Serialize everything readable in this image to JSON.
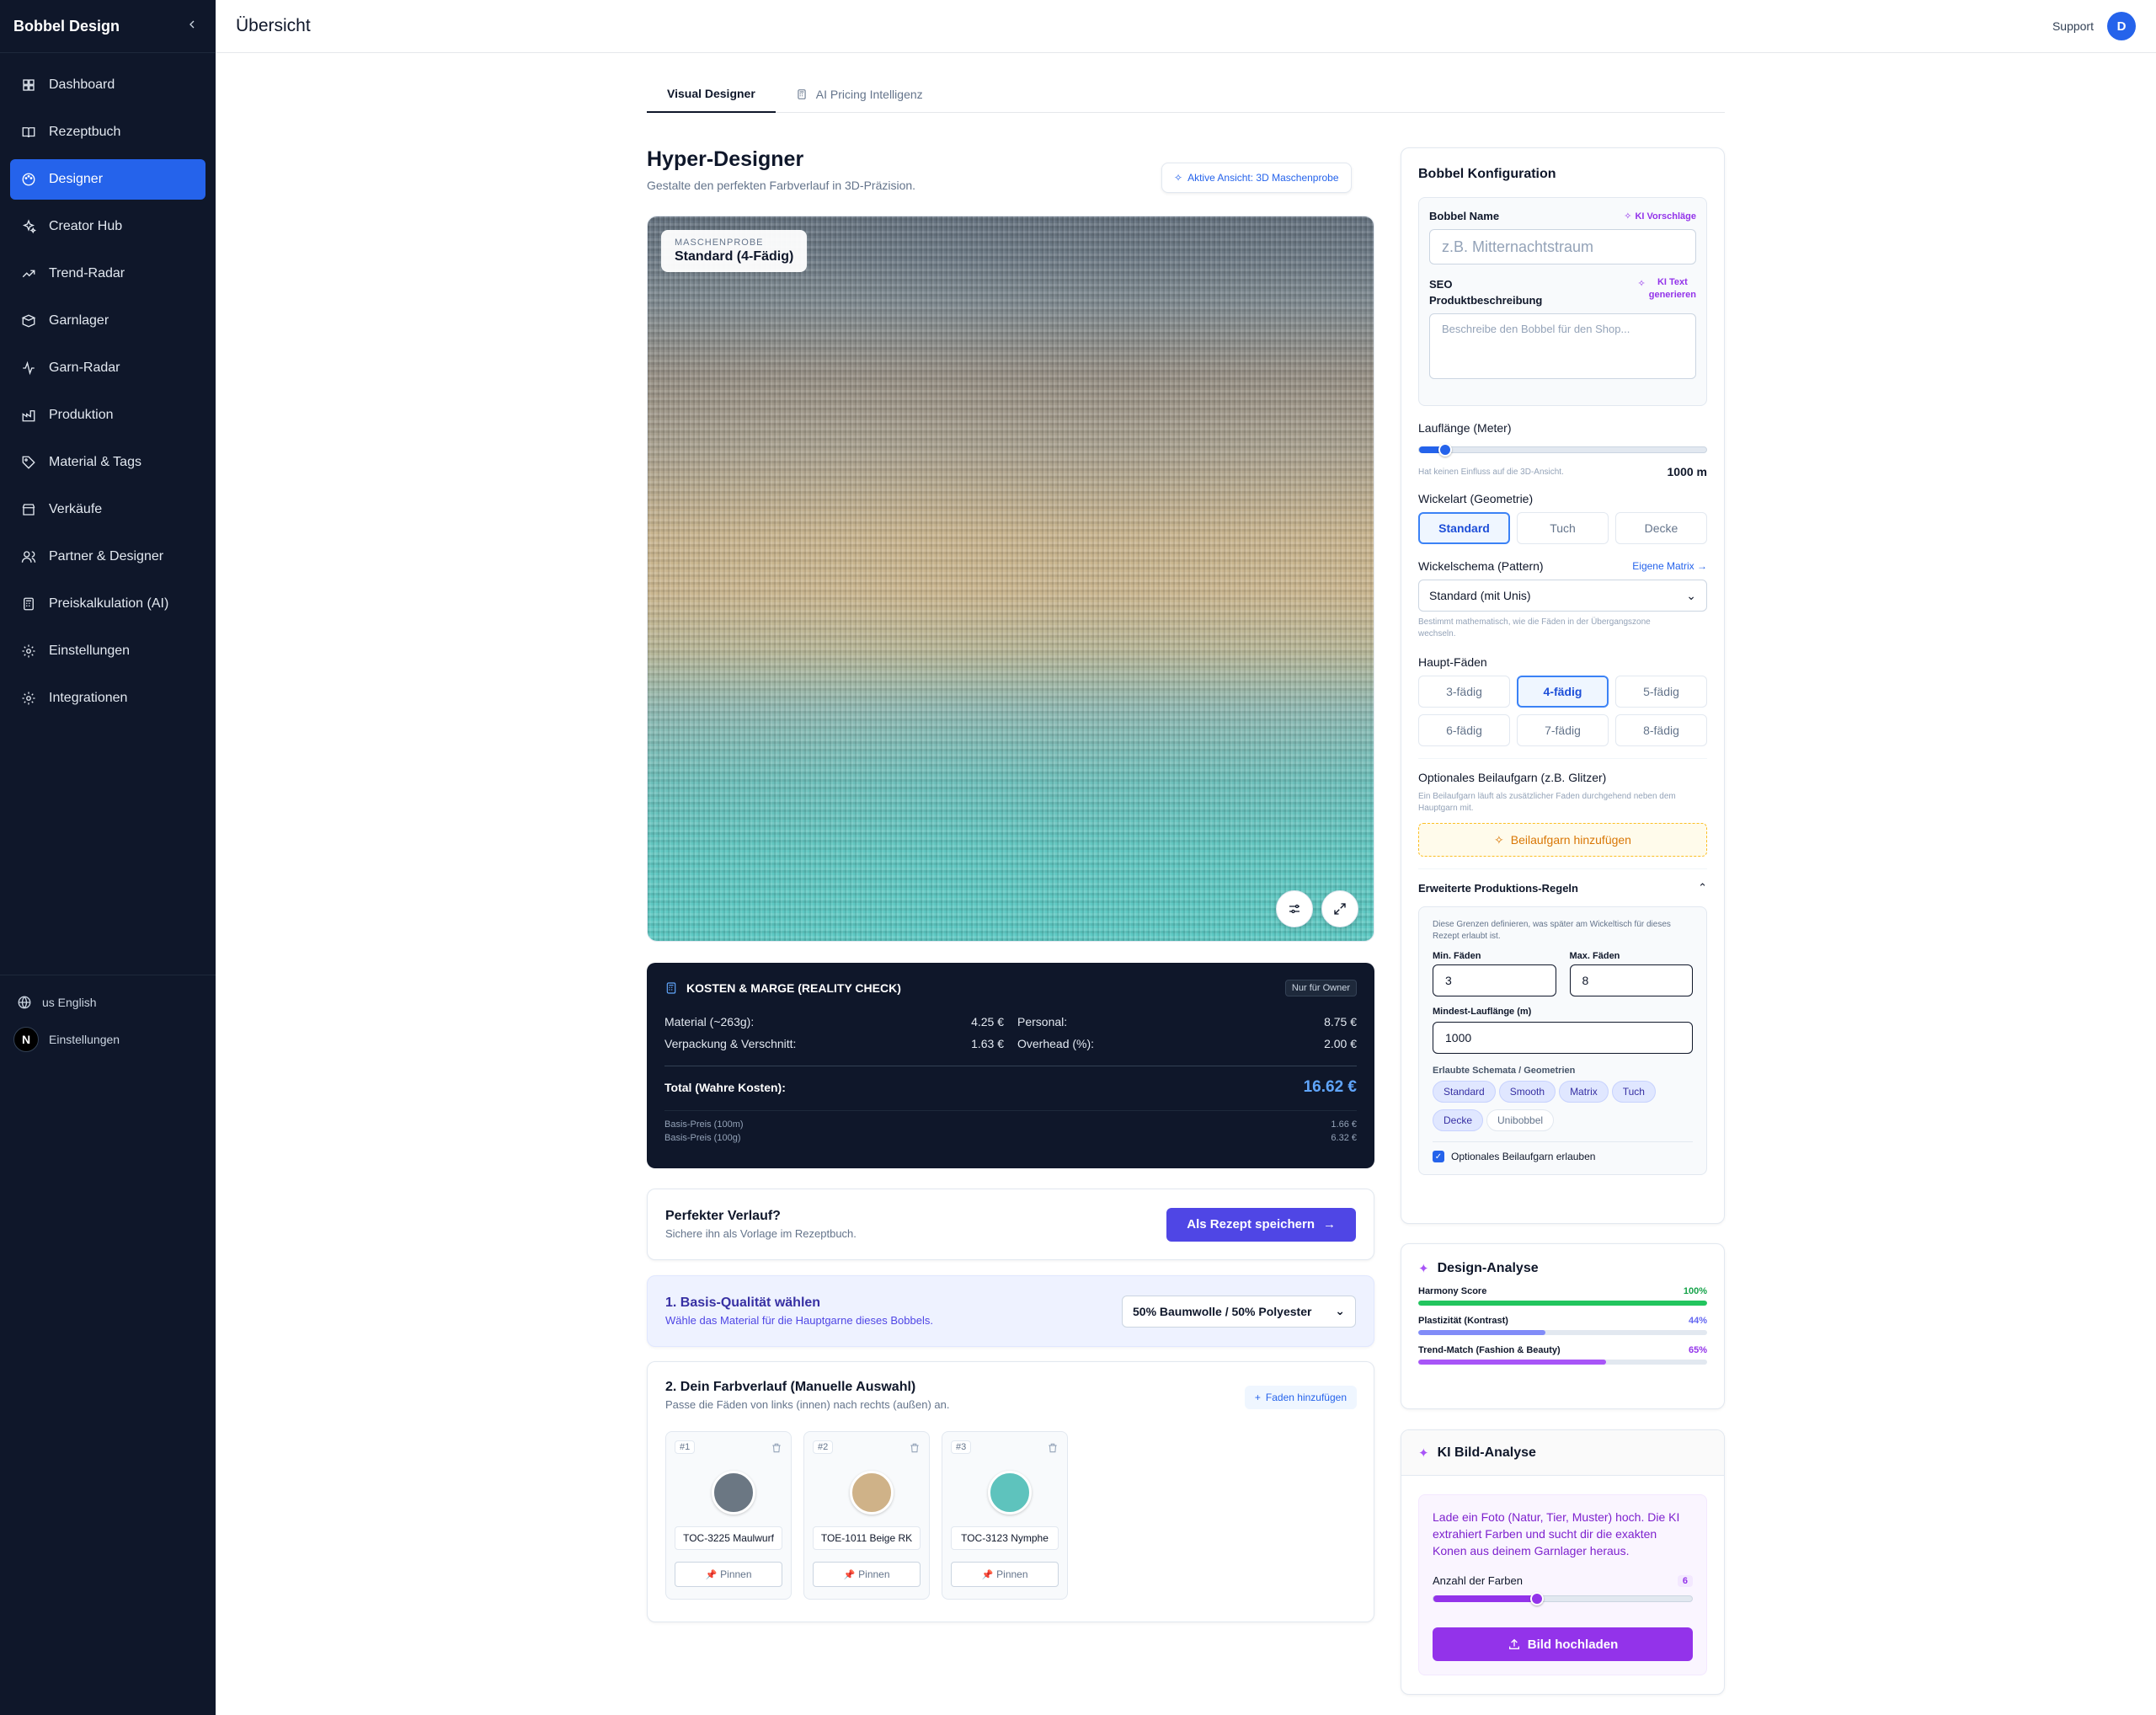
{
  "sidebar": {
    "brand": "Bobbel Design",
    "items": [
      {
        "label": "Dashboard",
        "icon": "dashboard-icon"
      },
      {
        "label": "Rezeptbuch",
        "icon": "book-icon"
      },
      {
        "label": "Designer",
        "icon": "palette-icon",
        "active": true
      },
      {
        "label": "Creator Hub",
        "icon": "sparkles-icon"
      },
      {
        "label": "Trend-Radar",
        "icon": "trending-up-icon"
      },
      {
        "label": "Garnlager",
        "icon": "box-icon"
      },
      {
        "label": "Garn-Radar",
        "icon": "activity-icon"
      },
      {
        "label": "Produktion",
        "icon": "factory-icon"
      },
      {
        "label": "Material & Tags",
        "icon": "tag-icon"
      },
      {
        "label": "Verkäufe",
        "icon": "store-icon"
      },
      {
        "label": "Partner & Designer",
        "icon": "users-icon"
      },
      {
        "label": "Preiskalkulation (AI)",
        "icon": "calculator-icon"
      },
      {
        "label": "Einstellungen",
        "icon": "gear-icon"
      },
      {
        "label": "Integrationen",
        "icon": "gear-icon"
      }
    ],
    "footer": {
      "language": "us English",
      "settings": "Einstellungen",
      "badge": "N"
    }
  },
  "header": {
    "title": "Übersicht",
    "support": "Support",
    "avatar": "D"
  },
  "tabs": [
    {
      "label": "Visual Designer",
      "active": true
    },
    {
      "label": "AI Pricing Intelligenz",
      "active": false
    }
  ],
  "designer": {
    "title": "Hyper-Designer",
    "subtitle": "Gestalte den perfekten Farbverlauf in 3D-Präzision.",
    "view_pill": "Aktive Ansicht: 3D Maschenprobe",
    "sample_label": "MASCHENPROBE",
    "sample_value": "Standard (4-Fädig)"
  },
  "cost": {
    "title": "KOSTEN & MARGE (REALITY CHECK)",
    "badge": "Nur für Owner",
    "rows": [
      {
        "label": "Material (~263g):",
        "value": "4.25 €"
      },
      {
        "label": "Personal:",
        "value": "8.75 €"
      },
      {
        "label": "Verpackung & Verschnitt:",
        "value": "1.63 €"
      },
      {
        "label": "Overhead (%):",
        "value": "2.00 €"
      }
    ],
    "total_label": "Total (Wahre Kosten):",
    "total_value": "16.62 €",
    "base": [
      {
        "label": "Basis-Preis (100m)",
        "value": "1.66 €"
      },
      {
        "label": "Basis-Preis (100g)",
        "value": "6.32 €"
      }
    ]
  },
  "save": {
    "title": "Perfekter Verlauf?",
    "subtitle": "Sichere ihn als Vorlage im Rezeptbuch.",
    "button": "Als Rezept speichern"
  },
  "basis": {
    "title": "1. Basis-Qualität wählen",
    "subtitle": "Wähle das Material für die Hauptgarne dieses Bobbels.",
    "selected": "50% Baumwolle / 50% Polyester"
  },
  "farbverlauf": {
    "title": "2. Dein Farbverlauf (Manuelle Auswahl)",
    "subtitle": "Passe die Fäden von links (innen) nach rechts (außen) an.",
    "add_button": "Faden hinzufügen",
    "pin_label": "Pinnen",
    "yarns": [
      {
        "num": "#1",
        "name": "TOC-3225 Maulwurf",
        "color": "#6b7783"
      },
      {
        "num": "#2",
        "name": "TOE-1011 Beige RK",
        "color": "#cfb288"
      },
      {
        "num": "#3",
        "name": "TOC-3123 Nymphe",
        "color": "#5ec3bd"
      }
    ]
  },
  "config": {
    "title": "Bobbel Konfiguration",
    "name_label": "Bobbel Name",
    "ki_suggest": "KI Vorschläge",
    "name_placeholder": "z.B. Mitternachtstraum",
    "seo_label_1": "SEO",
    "seo_label_2": "Produktbeschreibung",
    "ki_text_1": "KI Text",
    "ki_text_2": "generieren",
    "seo_placeholder": "Beschreibe den Bobbel für den Shop...",
    "laenge_label": "Lauflänge (Meter)",
    "laenge_fraction": 0.09,
    "laenge_note": "Hat keinen Einfluss auf die 3D-Ansicht.",
    "laenge_value": "1000 m",
    "wickel_label": "Wickelart (Geometrie)",
    "wickel_options": [
      "Standard",
      "Tuch",
      "Decke"
    ],
    "schema_label": "Wickelschema (Pattern)",
    "schema_link": "Eigene Matrix",
    "schema_selected": "Standard (mit Unis)",
    "schema_note_1": "Bestimmt mathematisch, wie die Fäden in der Übergangszone",
    "schema_note_2": "wechseln.",
    "faeden_label": "Haupt-Fäden",
    "faeden_options": [
      "3-fädig",
      "4-fädig",
      "5-fädig",
      "6-fädig",
      "7-fädig",
      "8-fädig"
    ],
    "beilauf_label": "Optionales Beilaufgarn (z.B. Glitzer)",
    "beilauf_note_1": "Ein Beilaufgarn läuft als zusätzlicher Faden durchgehend neben dem",
    "beilauf_note_2": "Hauptgarn mit.",
    "beilauf_button": "Beilaufgarn hinzufügen",
    "prod_label": "Erweiterte Produktions-Regeln",
    "prod_note_1": "Diese Grenzen definieren, was später am Wickeltisch für dieses",
    "prod_note_2": "Rezept erlaubt ist.",
    "min_label": "Min. Fäden",
    "min_value": "3",
    "max_label": "Max. Fäden",
    "max_value": "8",
    "min_len_label": "Mindest-Lauflänge (m)",
    "min_len_value": "1000",
    "schemata_label": "Erlaubte Schemata / Geometrien",
    "chips": [
      {
        "label": "Standard",
        "on": true
      },
      {
        "label": "Smooth",
        "on": true
      },
      {
        "label": "Matrix",
        "on": true
      },
      {
        "label": "Tuch",
        "on": true
      },
      {
        "label": "Decke",
        "on": true
      },
      {
        "label": "Unibobbel",
        "on": false
      }
    ],
    "allow_beilauf": "Optionales Beilaufgarn erlauben"
  },
  "analysis": {
    "title": "Design-Analyse",
    "rows": [
      {
        "label": "Harmony Score",
        "value": "100%",
        "fraction": 1.0,
        "color": "#22c55e",
        "text_color": "#16a34a"
      },
      {
        "label": "Plastizität (Kontrast)",
        "value": "44%",
        "fraction": 0.44,
        "color": "#818cf8",
        "text_color": "#6366f1"
      },
      {
        "label": "Trend-Match (Fashion & Beauty)",
        "value": "65%",
        "fraction": 0.65,
        "color": "#a855f7",
        "text_color": "#9333ea"
      }
    ]
  },
  "ki_bild": {
    "title": "KI Bild-Analyse",
    "text": "Lade ein Foto (Natur, Tier, Muster) hoch. Die KI extrahiert Farben und sucht dir die exakten Konen aus deinem Garnlager heraus.",
    "count_label": "Anzahl der Farben",
    "count_value": "6",
    "count_fraction": 0.4,
    "button": "Bild hochladen"
  }
}
